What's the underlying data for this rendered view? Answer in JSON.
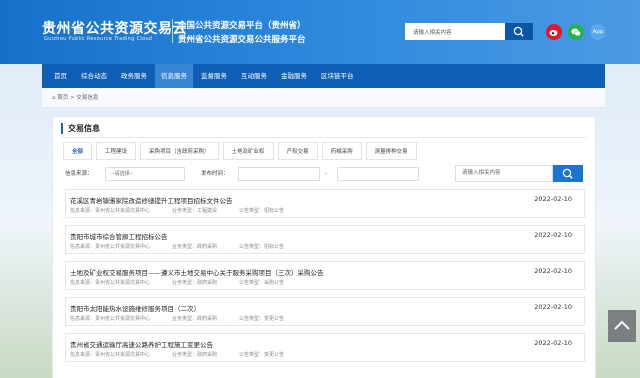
{
  "header": {
    "logo_cn": "贵州省公共资源交易云",
    "logo_en": "Guizhou Public Resource Trading Cloud",
    "subtitle_1": "全国公共资源交易平台（贵州省）",
    "subtitle_2": "贵州省公共资源交易公共服务平台",
    "search_placeholder": "请输入相关内容",
    "app_label": "App"
  },
  "nav": {
    "items": [
      "首页",
      "综合动态",
      "政务服务",
      "信息服务",
      "监督服务",
      "互动服务",
      "金融服务",
      "区块链平台"
    ],
    "active_index": 3
  },
  "breadcrumb": {
    "home": "首页",
    "current": "交易信息"
  },
  "panel": {
    "title": "交易信息",
    "tabs": [
      "全部",
      "工程建设",
      "采购项目（含政府采购）",
      "土地及矿业权",
      "产权交易",
      "药械采购",
      "测量排种交易"
    ],
    "active_tab": 0,
    "filter_label_source": "信息来源：",
    "filter_source_value": "--请选择--",
    "filter_label_date": "发布时间：",
    "date_separator": "-",
    "search_placeholder": "请输入相关内容"
  },
  "list": [
    {
      "title": "花溪区青岩镇骆家院改造修缮提升工程项目招标文件公告",
      "date": "2022-02-10",
      "source": "信息来源：贵州省公共资源交易中心",
      "biz_type": "业务类型：工程建设",
      "notice_type": "公告类型：招标公告"
    },
    {
      "title": "贵阳市城市综合管廊工程招标公告",
      "date": "2022-02-10",
      "source": "信息来源：贵州省公共资源交易中心",
      "biz_type": "业务类型：政府采购",
      "notice_type": "公告类型：招标公告"
    },
    {
      "title": "土地及矿业权交易服务项目——遵义市土地交易中心关于服务采购项目（三次）采购公告",
      "date": "2022-02-10",
      "source": "信息来源：贵州省公共资源交易中心",
      "biz_type": "业务类型：政府采购",
      "notice_type": "公告类型：采购公告"
    },
    {
      "title": "贵阳市太阳能热水设施维修服务项目（二次）",
      "date": "2022-02-10",
      "source": "信息来源：贵州省公共资源交易中心",
      "biz_type": "业务类型：政府采购",
      "notice_type": "公告类型：变更公告"
    },
    {
      "title": "贵州省交通运输厅高速公路养护工程施工变更公告",
      "date": "2022-02-10",
      "source": "信息来源：贵州省公共资源交易中心",
      "biz_type": "业务类型：政府采购",
      "notice_type": "公告类型：变更公告"
    }
  ],
  "colors": {
    "header_blue": "#1670c9",
    "nav_blue": "#0e5eb5",
    "accent_blue": "#1764c0",
    "weibo_red": "#e6162d",
    "wechat_green": "#20b44a"
  },
  "icons": [
    "search-icon",
    "weibo-icon",
    "wechat-icon",
    "app-icon",
    "home-icon",
    "back-to-top-icon"
  ]
}
